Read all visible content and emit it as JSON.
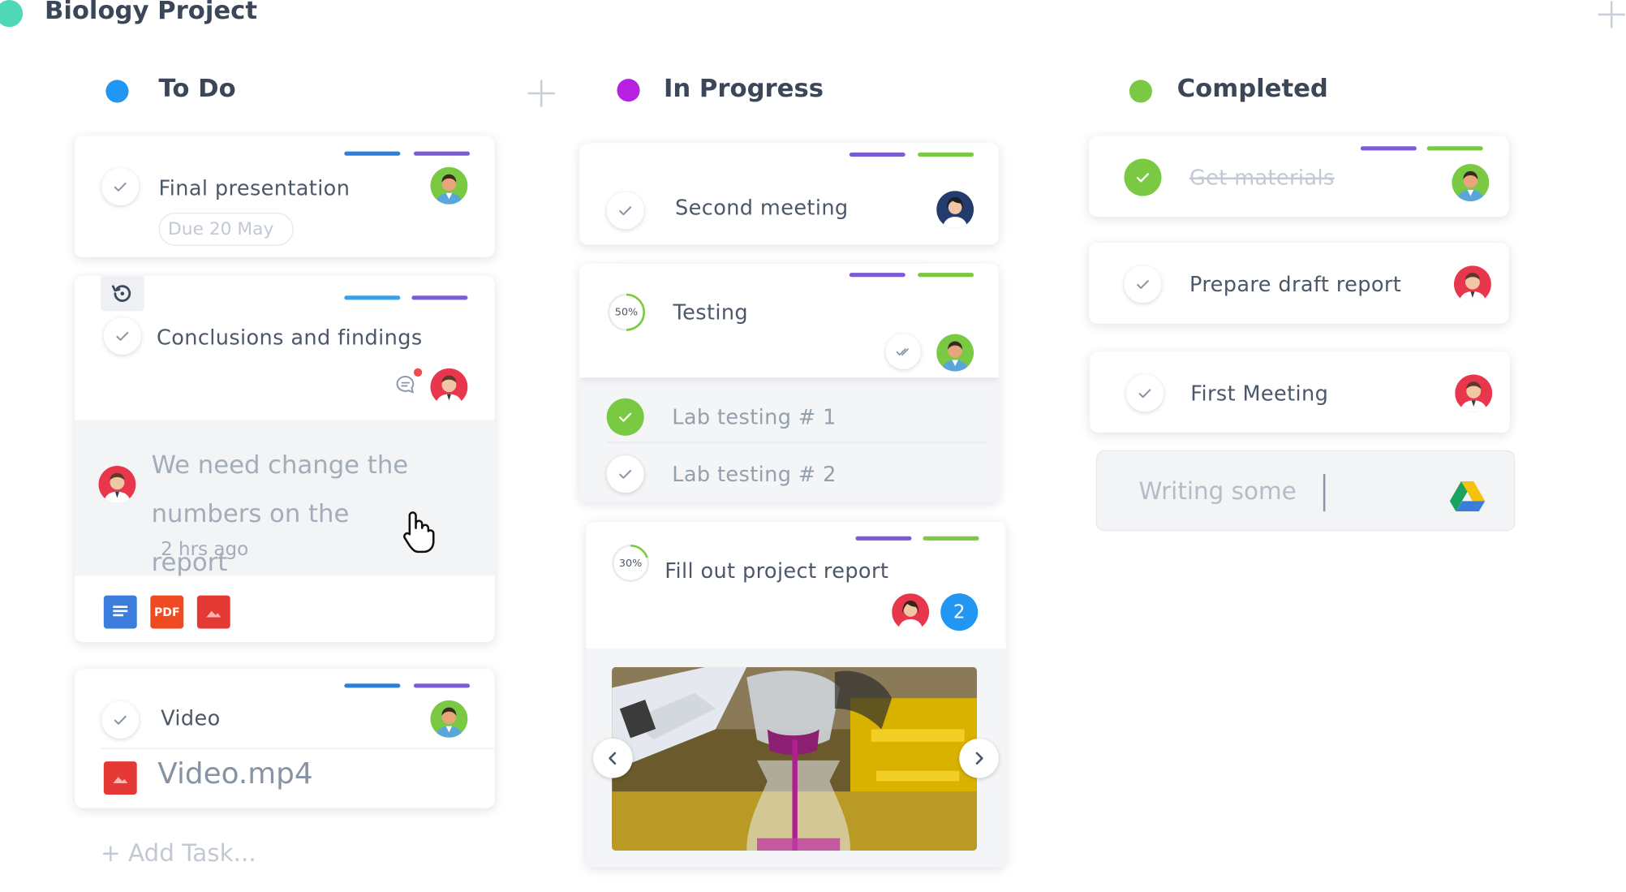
{
  "project": {
    "title": "Biology Project",
    "dot_color": "#4fd8b6"
  },
  "columns": [
    {
      "title": "To Do",
      "color": "#2196f3"
    },
    {
      "title": "In Progress",
      "color": "#b620e0"
    },
    {
      "title": "Completed",
      "color": "#7ac943"
    }
  ],
  "todo": {
    "final_presentation": {
      "title": "Final presentation",
      "due": "Due 20 May"
    },
    "conclusions": {
      "title": "Conclusions and findings",
      "comment": "We need change the numbers on the report",
      "comment_time": "2 hrs ago",
      "attachments": [
        "docs-icon",
        "pdf-icon",
        "image-icon"
      ],
      "pdf_label": "PDF"
    },
    "video": {
      "title": "Video",
      "file": "Video.mp4"
    },
    "add_task": "+ Add Task..."
  },
  "in_progress": {
    "second_meeting": {
      "title": "Second meeting"
    },
    "testing": {
      "title": "Testing",
      "progress": "50%",
      "subtasks": [
        {
          "label": "Lab testing # 1",
          "done": true
        },
        {
          "label": "Lab testing # 2",
          "done": false
        }
      ]
    },
    "report": {
      "title": "Fill out project report",
      "progress": "30%",
      "extra_members": "2"
    }
  },
  "completed": {
    "get_materials": {
      "title": "Get materials",
      "done": true
    },
    "draft_report": {
      "title": "Prepare draft report"
    },
    "first_meeting": {
      "title": "First Meeting"
    },
    "new_task_input": {
      "value": "Writing some",
      "icon": "google-drive-icon"
    }
  },
  "colors": {
    "blue_tag": "#2f7fd6",
    "purple_tag": "#7b5cd6",
    "green_tag": "#7ac943",
    "light_blue_tag": "#3aa0e8",
    "done_green": "#7ac943"
  }
}
